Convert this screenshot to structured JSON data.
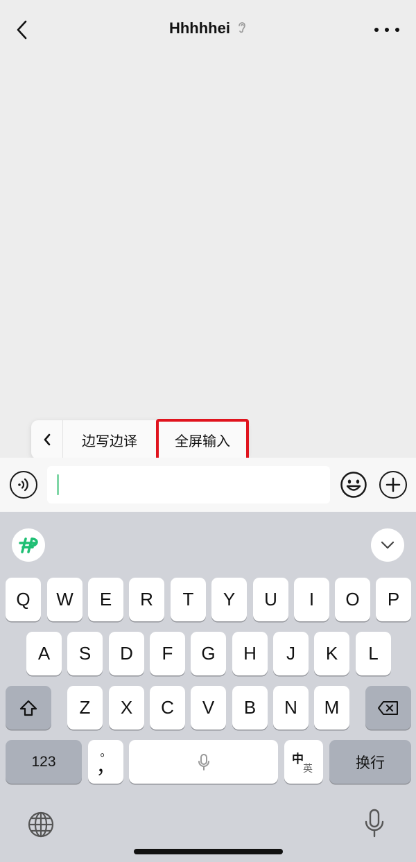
{
  "header": {
    "title": "Hhhhhei",
    "back_icon": "chevron-left-icon",
    "ear_icon": "ear-icon",
    "more_icon": "more-dots-icon"
  },
  "popup": {
    "items": [
      {
        "label": "边写边译"
      },
      {
        "label": "全屏输入"
      }
    ],
    "highlight_color": "#e0141e"
  },
  "input_bar": {
    "voice_icon": "voice-icon",
    "input_value": "",
    "emoji_icon": "emoji-icon",
    "plus_icon": "plus-icon",
    "caret_color": "#7fd6a6"
  },
  "keyboard": {
    "row1": [
      "Q",
      "W",
      "E",
      "R",
      "T",
      "Y",
      "U",
      "I",
      "O",
      "P"
    ],
    "row2": [
      "A",
      "S",
      "D",
      "F",
      "G",
      "H",
      "J",
      "K",
      "L"
    ],
    "row3": [
      "Z",
      "X",
      "C",
      "V",
      "B",
      "N",
      "M"
    ],
    "numbers_label": "123",
    "punct_top": "。",
    "punct_bottom": "，",
    "lang_top": "中",
    "lang_bottom": "英",
    "return_label": "换行",
    "shift_icon": "shift-icon",
    "delete_icon": "delete-icon",
    "mic_icon": "mic-icon",
    "globe_icon": "globe-icon",
    "logo_icon": "keyboard-logo-icon",
    "collapse_icon": "chevron-down-icon"
  }
}
